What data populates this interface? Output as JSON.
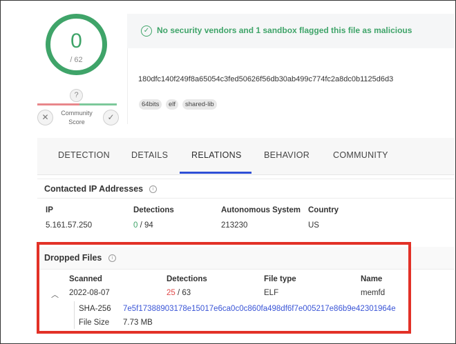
{
  "score": {
    "detected": "0",
    "total": "/ 62",
    "question": "?",
    "community_label": "Community Score",
    "vote_down": "✕",
    "vote_up": "✓"
  },
  "banner": {
    "message": "No security vendors and 1 sandbox flagged this file as malicious",
    "icon": "check-circle-icon"
  },
  "file": {
    "hash": "180dfc140f249f8a65054c3fed50626f56db30ab499c774fc2a8dc0b1125d6d3",
    "tags": [
      "64bits",
      "elf",
      "shared-lib"
    ]
  },
  "tabs": [
    "DETECTION",
    "DETAILS",
    "RELATIONS",
    "BEHAVIOR",
    "COMMUNITY"
  ],
  "active_tab": "RELATIONS",
  "contacted_ips": {
    "title": "Contacted IP Addresses",
    "headers": [
      "IP",
      "Detections",
      "Autonomous System",
      "Country"
    ],
    "rows": [
      {
        "ip": "5.161.57.250",
        "detected": "0",
        "total": " / 94",
        "as": "213230",
        "country": "US"
      }
    ]
  },
  "dropped_files": {
    "title": "Dropped Files",
    "headers": [
      "Scanned",
      "Detections",
      "File type",
      "Name"
    ],
    "rows": [
      {
        "scanned": "2022-08-07",
        "detected": "25",
        "total": " / 63",
        "type": "ELF",
        "name": "memfd"
      }
    ],
    "detail": {
      "sha_label": "SHA-256",
      "sha_value": "7e5f17388903178e15017e6ca0c0c860fa498df6f7e005217e86b9e42301964e",
      "size_label": "File Size",
      "size_value": "7.73 MB"
    }
  },
  "colors": {
    "accent_green": "#3fa469",
    "danger_red": "#e04848",
    "link_blue": "#3a55d6",
    "tab_active": "#2f4fd6",
    "highlight": "#e23127"
  }
}
